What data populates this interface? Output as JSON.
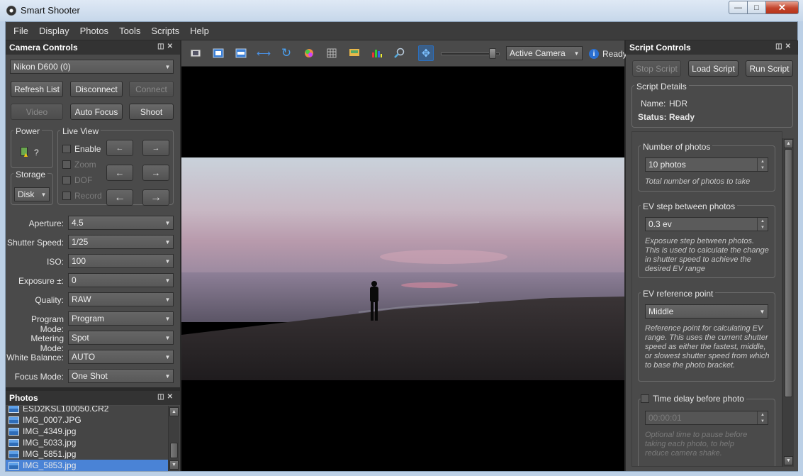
{
  "window": {
    "title": "Smart Shooter"
  },
  "menu": [
    "File",
    "Display",
    "Photos",
    "Tools",
    "Scripts",
    "Help"
  ],
  "camera_controls": {
    "title": "Camera Controls",
    "camera_select": "Nikon D600 (0)",
    "buttons": {
      "refresh": "Refresh List",
      "disconnect": "Disconnect",
      "connect": "Connect",
      "video": "Video",
      "autofocus": "Auto Focus",
      "shoot": "Shoot"
    },
    "power": {
      "title": "Power",
      "value": "?"
    },
    "storage": {
      "title": "Storage",
      "value": "Disk"
    },
    "liveview": {
      "title": "Live View",
      "enable": "Enable",
      "zoom": "Zoom",
      "dof": "DOF",
      "record": "Record"
    },
    "fields": [
      {
        "label": "Aperture:",
        "value": "4.5"
      },
      {
        "label": "Shutter Speed:",
        "value": "1/25"
      },
      {
        "label": "ISO:",
        "value": "100"
      },
      {
        "label": "Exposure ±:",
        "value": "0"
      },
      {
        "label": "Quality:",
        "value": "RAW"
      },
      {
        "label": "Program Mode:",
        "value": "Program"
      },
      {
        "label": "Metering Mode:",
        "value": "Spot"
      },
      {
        "label": "White Balance:",
        "value": "AUTO"
      },
      {
        "label": "Focus Mode:",
        "value": "One Shot"
      }
    ]
  },
  "photos": {
    "title": "Photos",
    "items": [
      "ESD2KSL100050.CR2",
      "IMG_0007.JPG",
      "IMG_4349.jpg",
      "IMG_5033.jpg",
      "IMG_5851.jpg",
      "IMG_5853.jpg"
    ]
  },
  "toolbar": {
    "camera_select": "Active Camera",
    "status": "Ready",
    "zoom_level": 0.95
  },
  "script_controls": {
    "title": "Script Controls",
    "buttons": {
      "stop": "Stop Script",
      "load": "Load Script",
      "run": "Run Script"
    },
    "details": {
      "title": "Script Details",
      "name_label": "Name:",
      "name_value": "HDR",
      "status_label": "Status:",
      "status_value": "Ready"
    },
    "num_photos": {
      "title": "Number of photos",
      "value": "10 photos",
      "hint": "Total number of photos to take"
    },
    "ev_step": {
      "title": "EV step between photos",
      "value": "0.3 ev",
      "hint": "Exposure step between photos. This is used to calculate the change in shutter speed to achieve the desired EV range"
    },
    "ev_ref": {
      "title": "EV reference point",
      "value": "Middle",
      "hint": "Reference point for calculating EV range. This uses the current shutter speed as either the fastest, middle, or slowest shutter speed from which to base the photo bracket."
    },
    "time_delay": {
      "title": "Time delay before photo",
      "value": "00:00:01",
      "hint": "Optional time to pause before taking each photo, to help reduce camera shake."
    }
  },
  "colors": {
    "accent": "#4a83d6",
    "panel": "#4a4a4a",
    "header": "#333333"
  }
}
